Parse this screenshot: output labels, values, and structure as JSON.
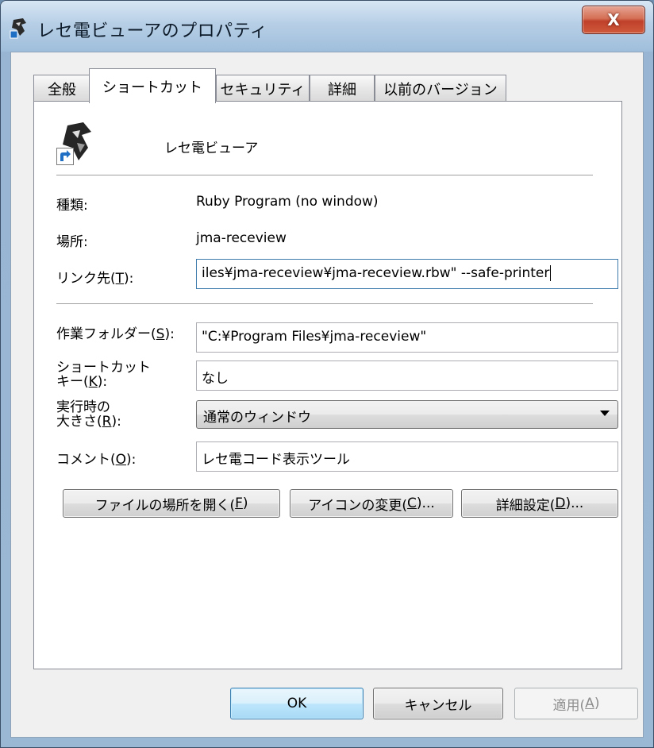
{
  "window": {
    "title": "レセ電ビューアのプロパティ",
    "close_label": "X"
  },
  "tabs": [
    {
      "label": "全般"
    },
    {
      "label": "ショートカット"
    },
    {
      "label": "セキュリティ"
    },
    {
      "label": "詳細"
    },
    {
      "label": "以前のバージョン"
    }
  ],
  "shortcut": {
    "name": "レセ電ビューア",
    "type_label": "種類:",
    "type_value": "Ruby Program (no window)",
    "location_label": "場所:",
    "location_value": "jma-receview",
    "target_label_pre": "リンク先(",
    "target_label_key": "T",
    "target_label_post": "):",
    "target_value": "iles¥jma-receview¥jma-receview.rbw\" --safe-printer",
    "workdir_label_pre": "作業フォルダー(",
    "workdir_label_key": "S",
    "workdir_label_post": "):",
    "workdir_value": "\"C:¥Program Files¥jma-receview\"",
    "hotkey_label_1": "ショートカット",
    "hotkey_label_2_pre": "キー(",
    "hotkey_label_2_key": "K",
    "hotkey_label_2_post": "):",
    "hotkey_value": "なし",
    "run_label_1": "実行時の",
    "run_label_2_pre": "大きさ(",
    "run_label_2_key": "R",
    "run_label_2_post": "):",
    "run_value": "通常のウィンドウ",
    "comment_label_pre": "コメント(",
    "comment_label_key": "O",
    "comment_label_post": "):",
    "comment_value": "レセ電コード表示ツール",
    "open_location_pre": "ファイルの場所を開く(",
    "open_location_key": "F",
    "open_location_post": ")",
    "change_icon_pre": "アイコンの変更(",
    "change_icon_key": "C",
    "change_icon_post": ")...",
    "advanced_pre": "詳細設定(",
    "advanced_key": "D",
    "advanced_post": ")..."
  },
  "footer": {
    "ok": "OK",
    "cancel": "キャンセル",
    "apply_pre": "適用(",
    "apply_key": "A",
    "apply_post": ")"
  },
  "colors": {
    "accent": "#3c7fb1",
    "close_red": "#c0402a"
  },
  "icons": [
    "app-icon",
    "shortcut-arrow-icon",
    "close-icon",
    "chevron-down-icon"
  ]
}
